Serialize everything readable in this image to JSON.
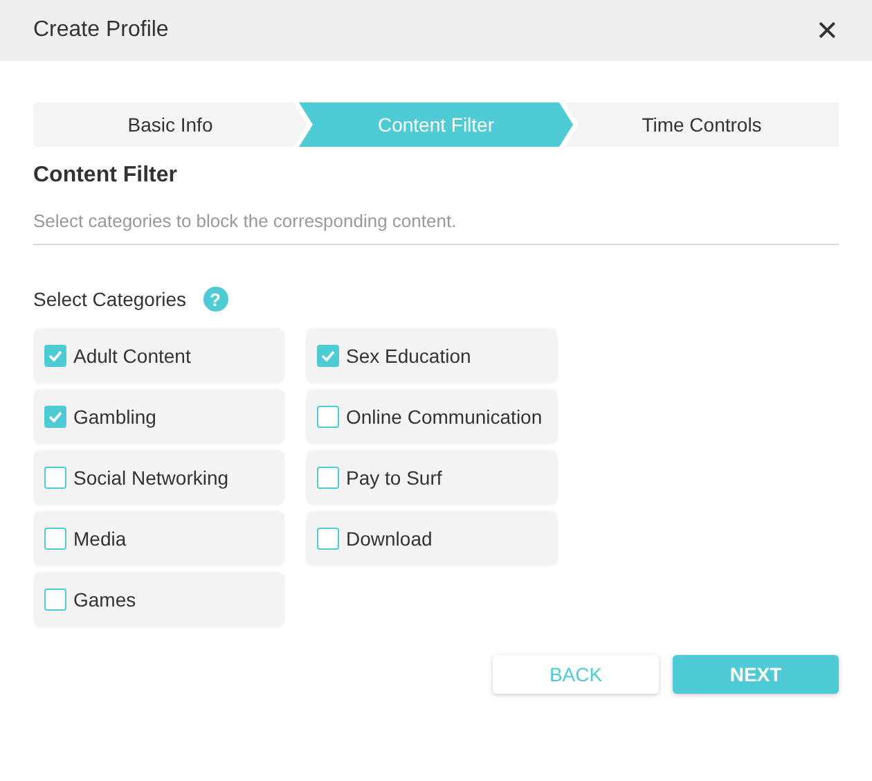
{
  "window": {
    "title": "Create Profile",
    "close": "✕"
  },
  "steps": [
    {
      "label": "Basic Info",
      "selected": false
    },
    {
      "label": "Content Filter",
      "selected": true
    },
    {
      "label": "Time Controls",
      "selected": false
    }
  ],
  "section": {
    "title": "Content Filter",
    "description": "Select categories to block the corresponding content."
  },
  "categories_label": "Select Categories",
  "help": "?",
  "categories": [
    {
      "label": "Adult Content",
      "checked": true
    },
    {
      "label": "Sex Education",
      "checked": true
    },
    {
      "label": "Gambling",
      "checked": true
    },
    {
      "label": "Online Communication",
      "checked": false
    },
    {
      "label": "Social Networking",
      "checked": false
    },
    {
      "label": "Pay to Surf",
      "checked": false
    },
    {
      "label": "Media",
      "checked": false
    },
    {
      "label": "Download",
      "checked": false
    },
    {
      "label": "Games",
      "checked": false
    }
  ],
  "buttons": [
    {
      "label": "BACK",
      "kind": "secondary"
    },
    {
      "label": "NEXT",
      "kind": "primary"
    }
  ]
}
